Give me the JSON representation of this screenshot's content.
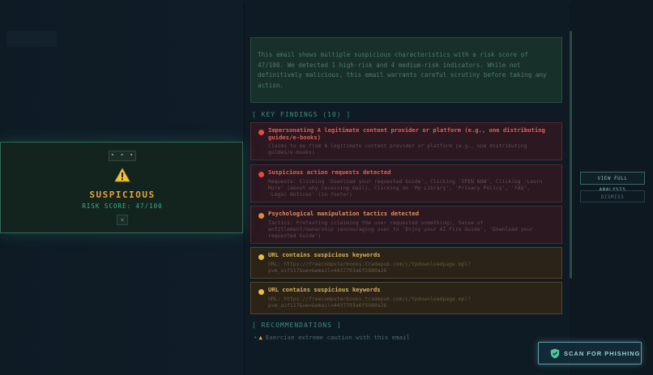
{
  "report": {
    "summary": "This email shows multiple suspicious characteristics with a risk score of 47/100. We detected 1 high-risk and 4 medium-risk indicators. While not definitively malicious, this email warrants careful scrutiny before taking any action.",
    "key_findings_heading": "[ KEY FINDINGS (10) ]",
    "findings": [
      {
        "title": "Impersonating A legitimate content provider or platform (e.g., one distributing guides/e-books)",
        "desc": "Claims to be from A legitimate content provider or platform (e.g., one distributing guides/e-books)",
        "severity": "high"
      },
      {
        "title": "Suspicious action requests detected",
        "desc": "Requests: Clicking 'Download your requested Guide', Clicking 'OPEN NOW', Clicking 'Learn More' (about why receiving mail), Clicking on 'My Library', 'Privacy Policy', 'FAQ', 'Legal Notices' (in footer)",
        "severity": "high"
      },
      {
        "title": "Psychological manipulation tactics detected",
        "desc": "Tactics: Pretexting (claiming the user requested something), Sense of entitlement/ownership (encouraging user to 'Enjoy your AI Fire Guide', 'Download your requested Guide')",
        "severity": "medium"
      },
      {
        "title": "URL contains suspicious keywords",
        "desc": "URL: https://freecomputerbooks.tradepub.com/c/tpdownloadpage.mpl?pvm_aif117&ue=&email=4437793a6f5980a26",
        "severity": "low"
      },
      {
        "title": "URL contains suspicious keywords",
        "desc": "URL: https://freecomputerbooks.tradepub.com/c/tpdownloadpage.mpl?pvm_aif117&ue=&email=4437793a6f5980a26",
        "severity": "low"
      }
    ],
    "recommendations_heading": "[ RECOMMENDATIONS ]",
    "recommendations": [
      "Exercise extreme caution with this email"
    ]
  },
  "actions": {
    "view_full_label": "VIEW FULL ANALYSIS",
    "dismiss_label": "DISMISS",
    "scan_label": "SCAN FOR PHISHING"
  },
  "popup": {
    "menu_label": "• • •",
    "status": "SUSPICIOUS",
    "risk_label": "RISK SCORE: 47/100",
    "close_label": "×"
  },
  "colors": {
    "high": "#e84a3e",
    "medium": "#e88a2e",
    "low": "#e8c23a",
    "accent": "#3fae8a",
    "warning": "#e8a23a"
  },
  "icons": {
    "warning": "warning-triangle-icon",
    "shield": "shield-icon",
    "close": "close-icon",
    "menu": "more-dots-icon"
  }
}
